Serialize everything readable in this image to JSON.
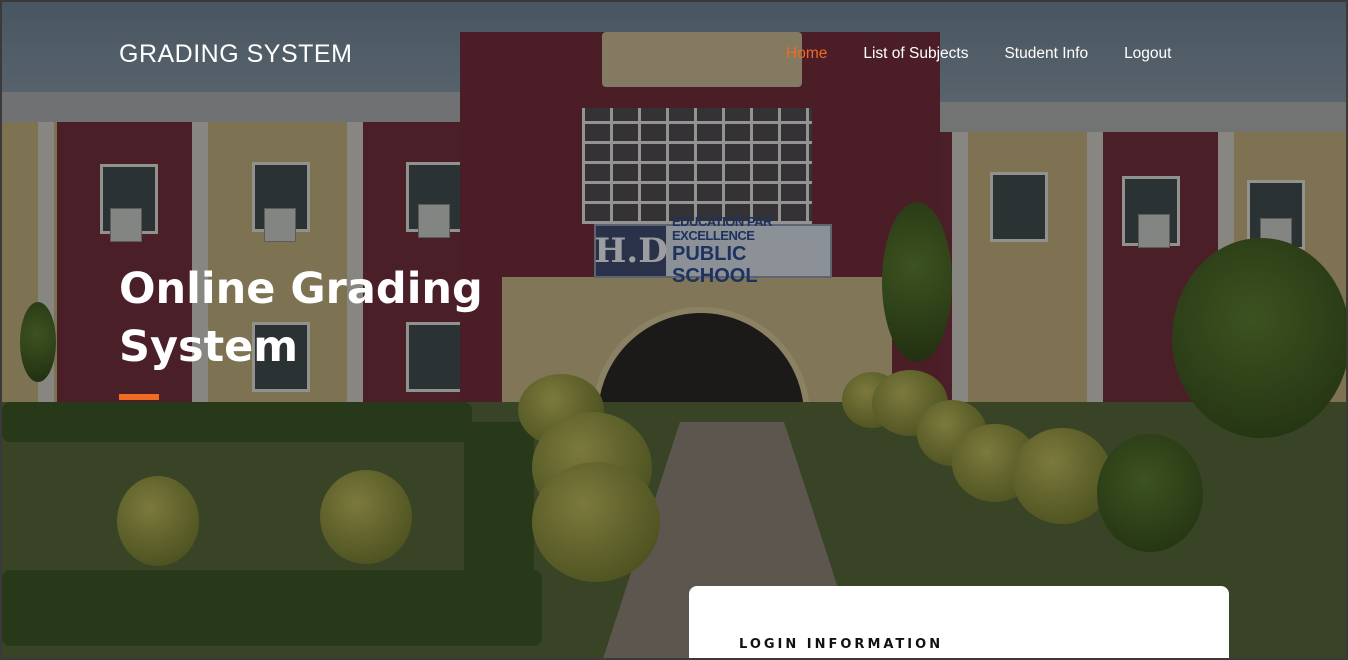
{
  "brand": {
    "title": "GRADING SYSTEM"
  },
  "nav": {
    "items": [
      {
        "label": "Home",
        "active": true
      },
      {
        "label": "List of Subjects",
        "active": false
      },
      {
        "label": "Student Info",
        "active": false
      },
      {
        "label": "Logout",
        "active": false
      }
    ]
  },
  "hero": {
    "headline_line1": "Online Grading",
    "headline_line2": "System",
    "sign_initials": "H.D",
    "sign_tagline": "EDUCATION PAR EXCELLENCE",
    "sign_school": "PUBLIC SCHOOL"
  },
  "login": {
    "title": "LOGIN INFORMATION"
  },
  "colors": {
    "accent": "#f06b24",
    "text": "#ffffff",
    "card": "#ffffff"
  }
}
